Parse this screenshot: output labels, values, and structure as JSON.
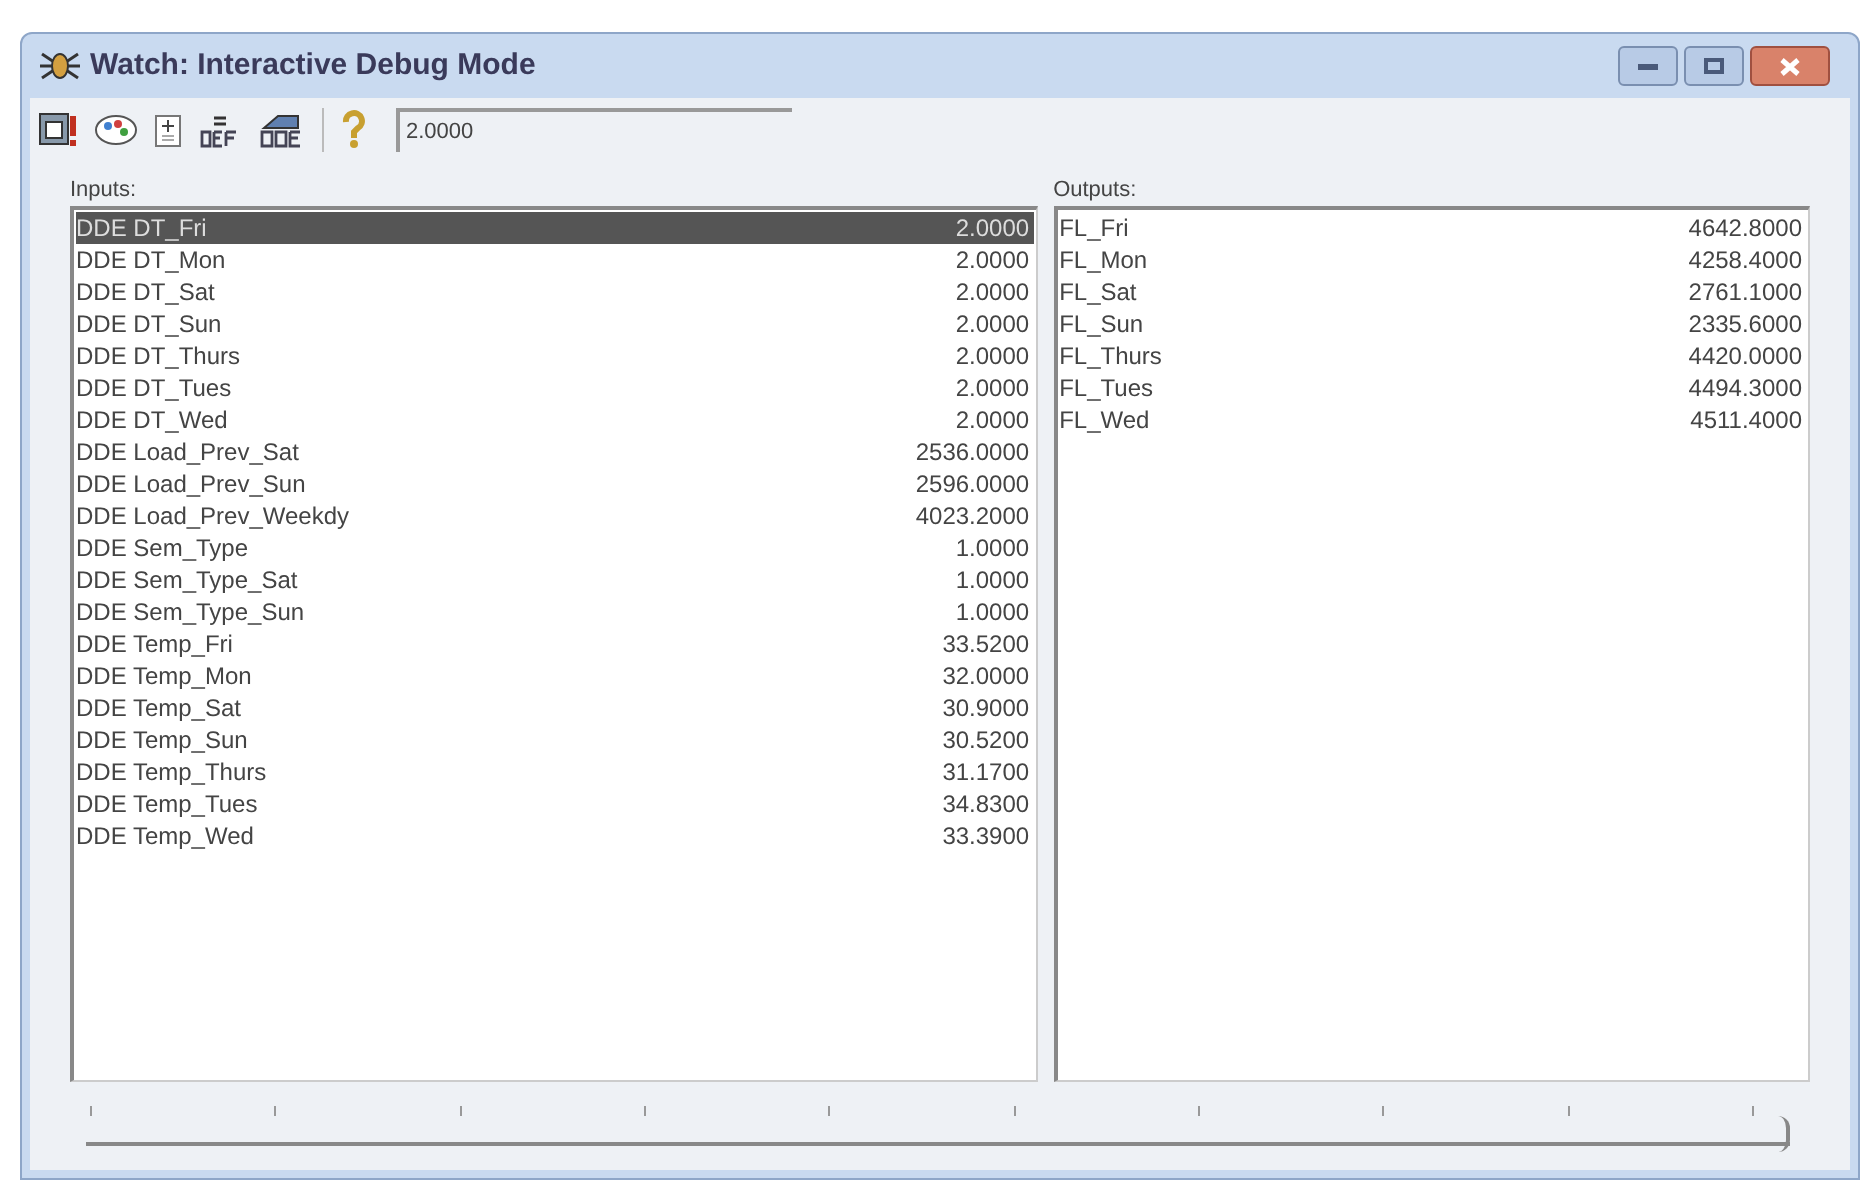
{
  "window": {
    "title": "Watch: Interactive Debug Mode"
  },
  "toolbar": {
    "value": "2.0000"
  },
  "inputs": {
    "label": "Inputs:",
    "rows": [
      {
        "name": "DDE DT_Fri",
        "value": "2.0000",
        "selected": true
      },
      {
        "name": "DDE DT_Mon",
        "value": "2.0000",
        "selected": false
      },
      {
        "name": "DDE DT_Sat",
        "value": "2.0000",
        "selected": false
      },
      {
        "name": "DDE DT_Sun",
        "value": "2.0000",
        "selected": false
      },
      {
        "name": "DDE DT_Thurs",
        "value": "2.0000",
        "selected": false
      },
      {
        "name": "DDE DT_Tues",
        "value": "2.0000",
        "selected": false
      },
      {
        "name": "DDE DT_Wed",
        "value": "2.0000",
        "selected": false
      },
      {
        "name": "DDE Load_Prev_Sat",
        "value": "2536.0000",
        "selected": false
      },
      {
        "name": "DDE Load_Prev_Sun",
        "value": "2596.0000",
        "selected": false
      },
      {
        "name": "DDE Load_Prev_Weekdy",
        "value": "4023.2000",
        "selected": false
      },
      {
        "name": "DDE Sem_Type",
        "value": "1.0000",
        "selected": false
      },
      {
        "name": "DDE Sem_Type_Sat",
        "value": "1.0000",
        "selected": false
      },
      {
        "name": "DDE Sem_Type_Sun",
        "value": "1.0000",
        "selected": false
      },
      {
        "name": "DDE Temp_Fri",
        "value": "33.5200",
        "selected": false
      },
      {
        "name": "DDE Temp_Mon",
        "value": "32.0000",
        "selected": false
      },
      {
        "name": "DDE Temp_Sat",
        "value": "30.9000",
        "selected": false
      },
      {
        "name": "DDE Temp_Sun",
        "value": "30.5200",
        "selected": false
      },
      {
        "name": "DDE Temp_Thurs",
        "value": "31.1700",
        "selected": false
      },
      {
        "name": "DDE Temp_Tues",
        "value": "34.8300",
        "selected": false
      },
      {
        "name": "DDE Temp_Wed",
        "value": "33.3900",
        "selected": false
      }
    ]
  },
  "outputs": {
    "label": "Outputs:",
    "rows": [
      {
        "name": "FL_Fri",
        "value": "4642.8000"
      },
      {
        "name": "FL_Mon",
        "value": "4258.4000"
      },
      {
        "name": "FL_Sat",
        "value": "2761.1000"
      },
      {
        "name": "FL_Sun",
        "value": "2335.6000"
      },
      {
        "name": "FL_Thurs",
        "value": "4420.0000"
      },
      {
        "name": "FL_Tues",
        "value": "4494.3000"
      },
      {
        "name": "FL_Wed",
        "value": "4511.4000"
      }
    ]
  },
  "slider": {
    "level": 1
  }
}
